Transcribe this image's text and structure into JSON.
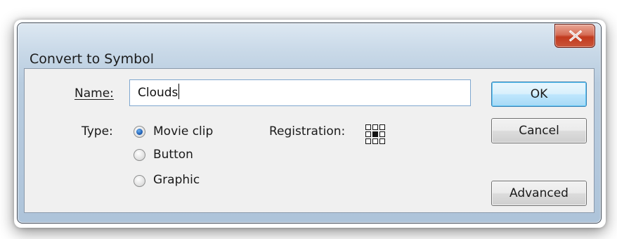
{
  "dialog": {
    "title": "Convert to Symbol",
    "close_symbol": "X"
  },
  "name_field": {
    "label": "Name:",
    "value": "Clouds"
  },
  "type": {
    "label": "Type:",
    "options": [
      {
        "label": "Movie clip",
        "selected": true
      },
      {
        "label": "Button",
        "selected": false
      },
      {
        "label": "Graphic",
        "selected": false
      }
    ]
  },
  "registration": {
    "label": "Registration:",
    "selected_point": "center"
  },
  "buttons": {
    "ok": "OK",
    "cancel": "Cancel",
    "advanced": "Advanced"
  }
}
